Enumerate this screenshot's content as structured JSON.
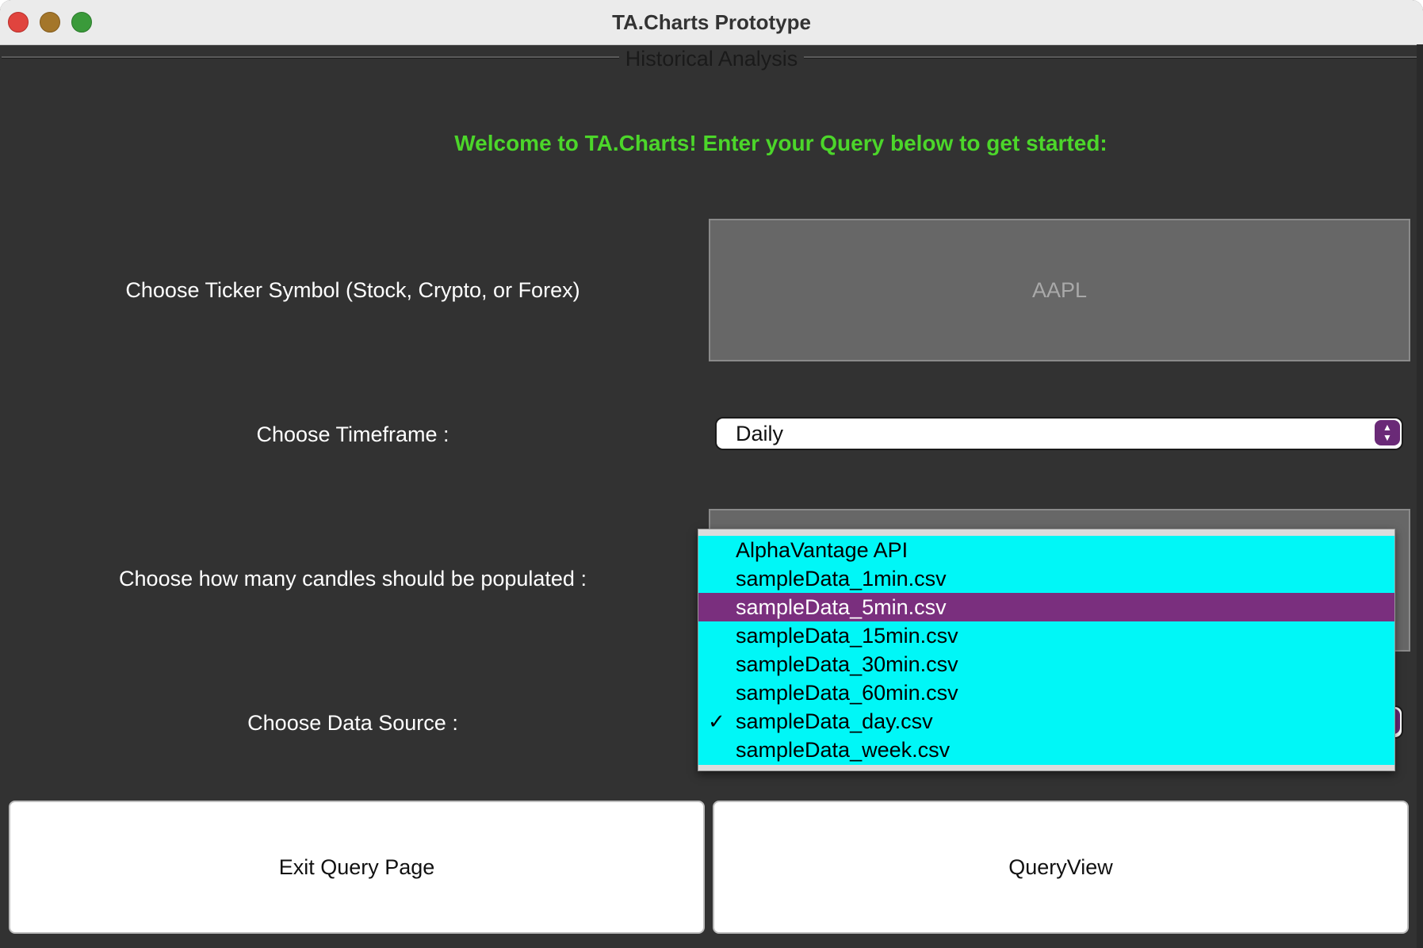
{
  "window": {
    "title": "TA.Charts Prototype"
  },
  "panel": {
    "title": "Historical Analysis",
    "welcome": "Welcome to TA.Charts! Enter your Query below to get started:"
  },
  "form": {
    "ticker_label": "Choose Ticker Symbol (Stock, Crypto, or Forex)",
    "ticker_value": "AAPL",
    "timeframe_label": "Choose Timeframe :",
    "timeframe_value": "Daily",
    "candles_label": "Choose how many candles should be populated :",
    "source_label": "Choose Data Source :"
  },
  "dropdown": {
    "items": [
      {
        "label": "AlphaVantage API",
        "checked": false,
        "highlighted": false
      },
      {
        "label": "sampleData_1min.csv",
        "checked": false,
        "highlighted": false
      },
      {
        "label": "sampleData_5min.csv",
        "checked": false,
        "highlighted": true
      },
      {
        "label": "sampleData_15min.csv",
        "checked": false,
        "highlighted": false
      },
      {
        "label": "sampleData_30min.csv",
        "checked": false,
        "highlighted": false
      },
      {
        "label": "sampleData_60min.csv",
        "checked": false,
        "highlighted": false
      },
      {
        "label": "sampleData_day.csv",
        "checked": true,
        "highlighted": false
      },
      {
        "label": "sampleData_week.csv",
        "checked": false,
        "highlighted": false
      }
    ],
    "check_glyph": "✓"
  },
  "buttons": {
    "exit": "Exit Query Page",
    "query": "QueryView"
  },
  "colors": {
    "welcome": "#4cd62a",
    "dropdown_bg": "#00f7f7",
    "dropdown_highlight": "#7a2f7e",
    "stepper": "#6a2a77"
  }
}
